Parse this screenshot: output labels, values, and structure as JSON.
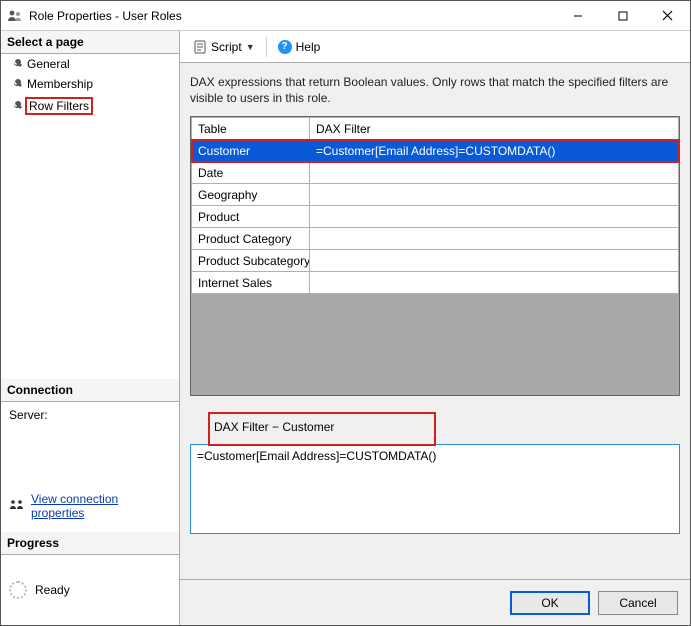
{
  "window": {
    "title": "Role Properties - User Roles"
  },
  "sidebar": {
    "select_page_header": "Select a page",
    "pages": [
      {
        "label": "General"
      },
      {
        "label": "Membership"
      },
      {
        "label": "Row Filters"
      }
    ],
    "connection_header": "Connection",
    "server_label": "Server:",
    "view_connection_link": "View connection properties",
    "progress_header": "Progress",
    "progress_status": "Ready"
  },
  "toolbar": {
    "script_label": "Script",
    "help_label": "Help"
  },
  "main": {
    "description": "DAX expressions that return Boolean values. Only rows that match the specified filters are visible to users in this role.",
    "columns": {
      "table": "Table",
      "dax": "DAX Filter"
    },
    "rows": [
      {
        "table": "Customer",
        "dax": "=Customer[Email Address]=CUSTOMDATA()",
        "selected": true
      },
      {
        "table": "Date",
        "dax": ""
      },
      {
        "table": "Geography",
        "dax": ""
      },
      {
        "table": "Product",
        "dax": ""
      },
      {
        "table": "Product Category",
        "dax": ""
      },
      {
        "table": "Product Subcategory",
        "dax": ""
      },
      {
        "table": "Internet Sales",
        "dax": ""
      }
    ],
    "editor_label": "DAX Filter − Customer",
    "editor_value": "=Customer[Email Address]=CUSTOMDATA()"
  },
  "buttons": {
    "ok": "OK",
    "cancel": "Cancel"
  }
}
